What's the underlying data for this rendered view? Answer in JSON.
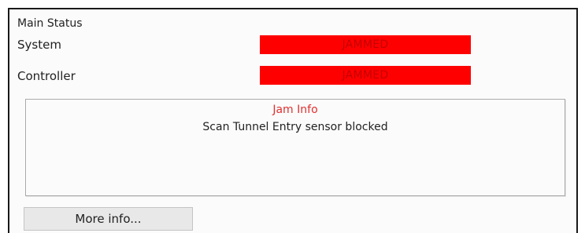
{
  "main_status": {
    "title": "Main Status",
    "rows": [
      {
        "label": "System",
        "status": "JAMMED"
      },
      {
        "label": "Controller",
        "status": "JAMMED"
      }
    ],
    "status_color": "#ff0000"
  },
  "jam_info": {
    "title": "Jam Info",
    "message": "Scan Tunnel Entry sensor blocked",
    "title_color": "#e03030"
  },
  "more_info_button": {
    "label": "More info..."
  }
}
